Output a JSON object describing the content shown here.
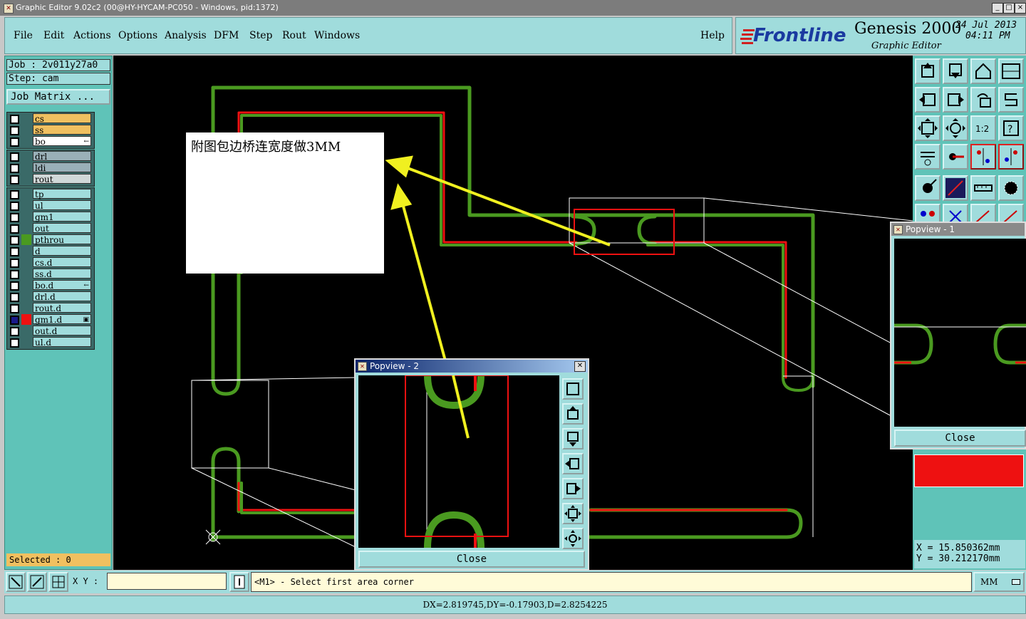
{
  "window": {
    "title": "Graphic Editor 9.02c2 (00@HY-HYCAM-PC050 - Windows, pid:1372)",
    "controls": [
      "_",
      "□",
      "×"
    ]
  },
  "menu": {
    "items": [
      "File",
      "Edit",
      "Actions",
      "Options",
      "Analysis",
      "DFM",
      "Step",
      "Rout",
      "Windows"
    ],
    "help": "Help"
  },
  "brand": {
    "logo": "Frontline",
    "product": "Genesis 2000",
    "subtitle": "Graphic Editor",
    "date": "24 Jul 2013",
    "time": "04:11 PM"
  },
  "job_panel": {
    "job": "Job  : 2v011y27a0",
    "step": "Step: cam",
    "job_matrix": "Job Matrix ...",
    "selected": "Selected : 0"
  },
  "layer_groups": [
    [
      {
        "name": "cs",
        "bg": "#f0c060",
        "swatch": "",
        "checked": false
      },
      {
        "name": "ss",
        "bg": "#f0c060",
        "swatch": "",
        "checked": false
      },
      {
        "name": "bo",
        "bg": "#ffffff",
        "swatch": "",
        "checked": false,
        "mark": "←"
      }
    ],
    [
      {
        "name": "drl",
        "bg": "#9ab0b8",
        "swatch": "",
        "checked": false
      },
      {
        "name": "ldi",
        "bg": "#9ab0b8",
        "swatch": "",
        "checked": false
      },
      {
        "name": "rout",
        "bg": "#d0d8d8",
        "swatch": "",
        "checked": false
      }
    ],
    [
      {
        "name": "tp",
        "bg": "#a0dcdc",
        "swatch": "",
        "checked": false
      },
      {
        "name": "ul",
        "bg": "#a0dcdc",
        "swatch": "",
        "checked": false
      },
      {
        "name": "gm1",
        "bg": "#a0dcdc",
        "swatch": "",
        "checked": false
      },
      {
        "name": "out",
        "bg": "#a0dcdc",
        "swatch": "",
        "checked": false
      },
      {
        "name": "pthrou",
        "bg": "#a0dcdc",
        "swatch": "#4a9a20",
        "checked": false
      },
      {
        "name": "d",
        "bg": "#a0dcdc",
        "swatch": "",
        "checked": false
      },
      {
        "name": "cs.d",
        "bg": "#a0dcdc",
        "swatch": "",
        "checked": false
      },
      {
        "name": "ss.d",
        "bg": "#a0dcdc",
        "swatch": "",
        "checked": false
      },
      {
        "name": "bo.d",
        "bg": "#a0dcdc",
        "swatch": "",
        "checked": false,
        "mark": "←"
      },
      {
        "name": "drl.d",
        "bg": "#a0dcdc",
        "swatch": "",
        "checked": false
      },
      {
        "name": "rout.d",
        "bg": "#a0dcdc",
        "swatch": "",
        "checked": false
      },
      {
        "name": "gm1.d",
        "bg": "#a0dcdc",
        "swatch": "#ee1111",
        "checked": true,
        "mark": "▣"
      },
      {
        "name": "out.d",
        "bg": "#a0dcdc",
        "swatch": "",
        "checked": false
      },
      {
        "name": "ul.d",
        "bg": "#a0dcdc",
        "swatch": "",
        "checked": false
      }
    ]
  ],
  "annotation": {
    "text": "附图包边桥连宽度做3MM"
  },
  "popview1": {
    "title": "Popview - 1",
    "close": "Close"
  },
  "popview2": {
    "title": "Popview - 2",
    "close": "Close"
  },
  "coords": {
    "x": "X  =  15.850362mm",
    "y": "Y  =  30.212170mm"
  },
  "statusbar": {
    "xy_label": "X Y :",
    "xy_value": "",
    "prompt": "<M1> - Select first area corner",
    "units": "MM"
  },
  "message": "DX=2.819745,DY=-0.17903,D=2.8254225",
  "colors": {
    "panel": "#a0dcdc",
    "side": "#5fc3b8",
    "trace_green": "#4a9a20",
    "trace_red": "#ee1111",
    "arrow": "#f0f020"
  }
}
